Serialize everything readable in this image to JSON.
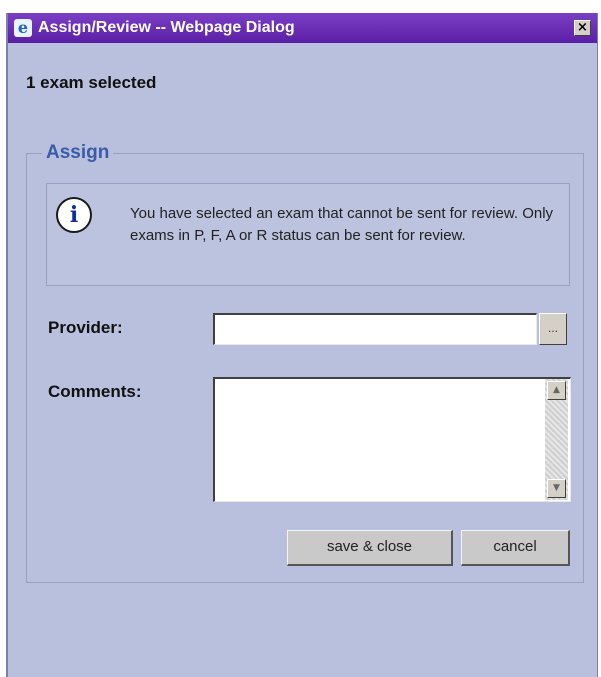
{
  "window": {
    "title": "Assign/Review -- Webpage Dialog",
    "close_glyph": "×"
  },
  "selection": {
    "count_text": "1 exam selected"
  },
  "assign": {
    "legend": "Assign",
    "info_message": "You have selected an exam that cannot be sent for review. Only exams in P, F, A or R status can be sent for review.",
    "info_icon_glyph": "i",
    "provider_label": "Provider:",
    "provider_value": "",
    "browse_label": "...",
    "comments_label": "Comments:",
    "comments_value": "",
    "scroll_up_glyph": "▲",
    "scroll_down_glyph": "▼"
  },
  "actions": {
    "save_label": "save & close",
    "cancel_label": "cancel"
  },
  "icons": {
    "app": "internet-explorer-icon",
    "info": "info-icon",
    "close": "close-icon"
  },
  "colors": {
    "titlebar": "#5a1fa4",
    "dialog_background": "#b9c0dd",
    "legend_text": "#3b5ba8",
    "button": "#c9c9c9"
  }
}
